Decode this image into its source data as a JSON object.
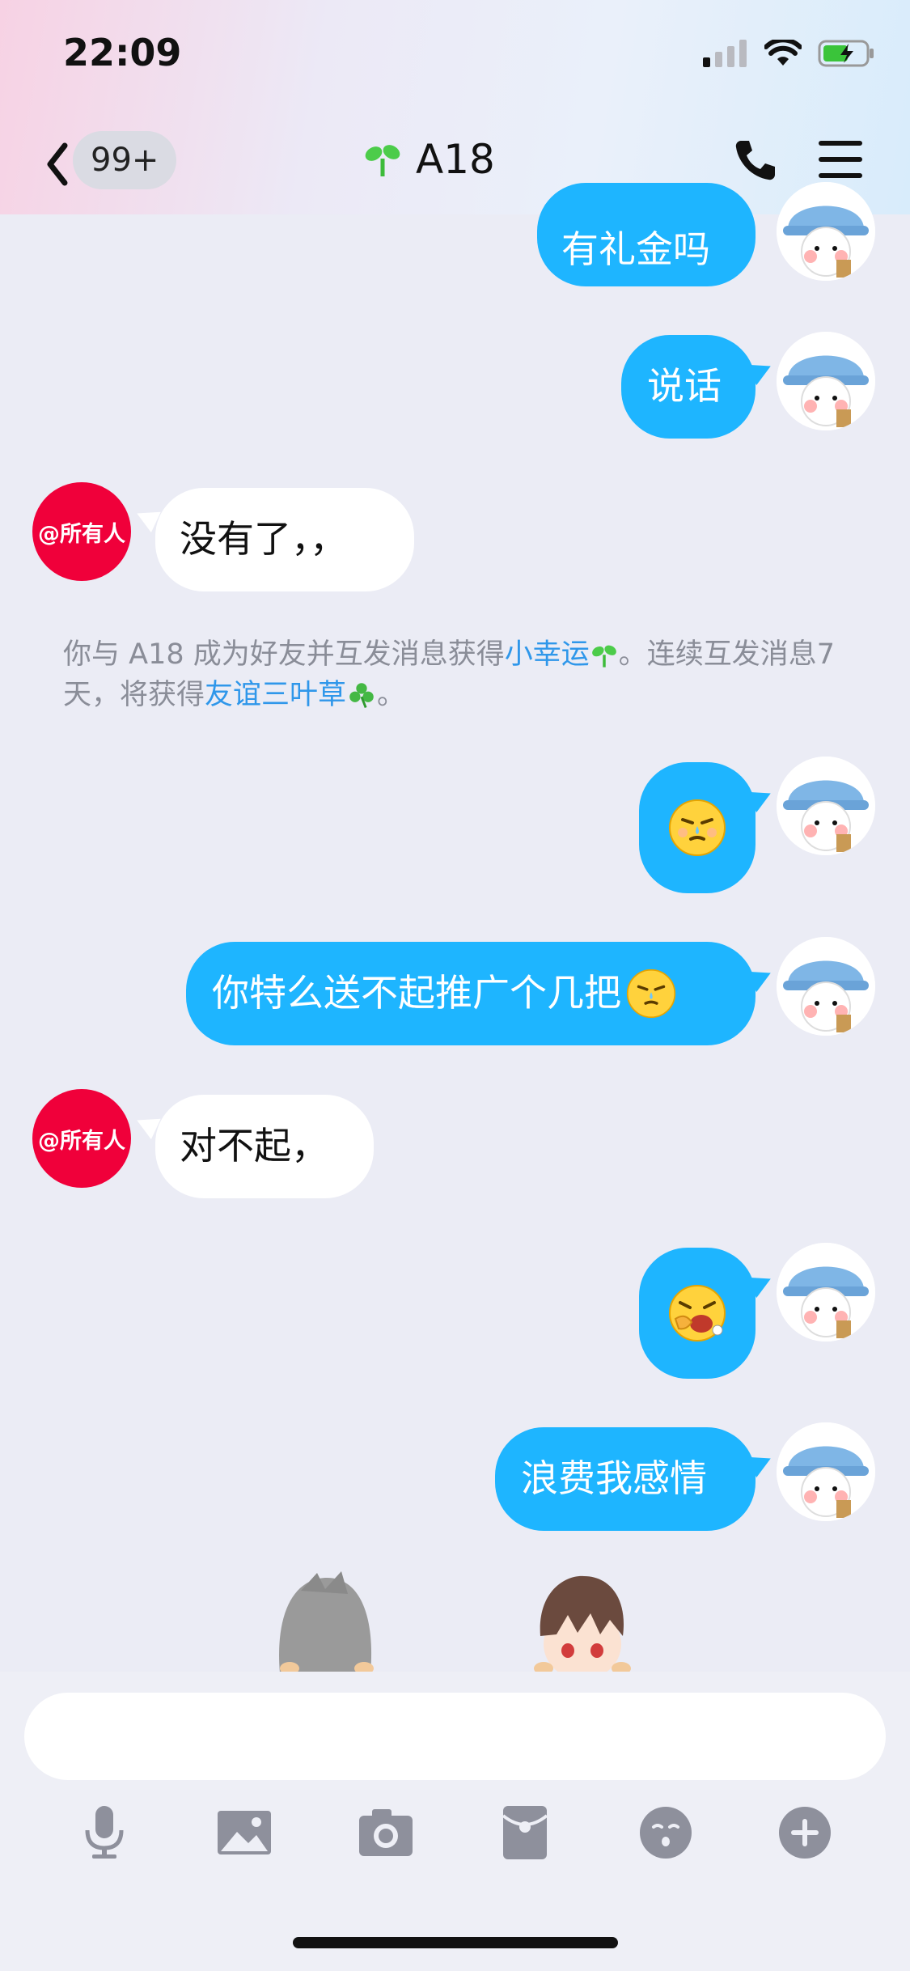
{
  "status": {
    "time": "22:09"
  },
  "header": {
    "back_badge": "99+",
    "title": "A18"
  },
  "messages": [
    {
      "side": "me",
      "text": "有礼金吗"
    },
    {
      "side": "me",
      "text": "说话"
    },
    {
      "side": "peer",
      "text": "没有了，，",
      "avatar_label": "@所有人"
    },
    {
      "side": "me",
      "emoji": "sweat-face"
    },
    {
      "side": "me",
      "text": "你特么送不起推广个几把"
    },
    {
      "side": "peer",
      "text": "对不起，",
      "avatar_label": "@所有人"
    },
    {
      "side": "me",
      "emoji": "yawn-face"
    },
    {
      "side": "me",
      "text": "浪费我感情"
    }
  ],
  "system_notice": {
    "part1": "你与 A18 成为好友并互发消息获得",
    "link1": "小幸运",
    "part2": "。连续互发消息7天，将获得",
    "link2": "友谊三叶草",
    "part3": "。"
  },
  "input": {
    "placeholder": ""
  },
  "toolbar": [
    "mic-icon",
    "image-icon",
    "camera-icon",
    "red-packet-icon",
    "emoji-icon",
    "plus-icon"
  ],
  "colors": {
    "bubble_me": "#1eb5ff",
    "bubble_peer": "#ffffff",
    "peer_avatar": "#f0003a",
    "link": "#2f97ea"
  }
}
